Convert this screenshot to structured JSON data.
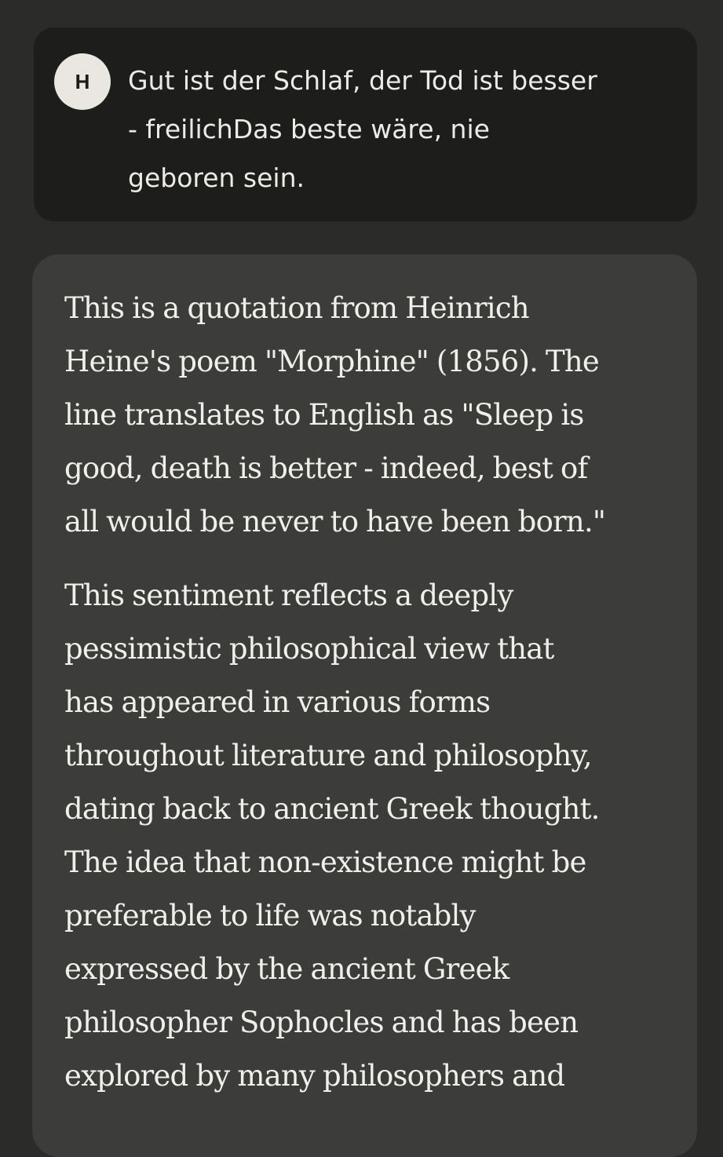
{
  "user_message": {
    "avatar_letter": "H",
    "lines": [
      "Gut ist der Schlaf, der Tod ist besser",
      "- freilichDas beste wäre, nie",
      "geboren sein."
    ]
  },
  "assistant_message": {
    "paragraph_1": [
      "This is a quotation from Heinrich",
      "Heine's poem \"Morphine\" (1856). The",
      "line translates to English as \"Sleep is",
      "good, death is better - indeed, best of",
      "all would be never to have been born.\""
    ],
    "paragraph_2": [
      "This sentiment reflects a deeply",
      "pessimistic philosophical view that",
      "has appeared in various forms",
      "throughout literature and philosophy,",
      "dating back to ancient Greek thought.",
      "The idea that non-existence might be",
      "preferable to life was notably",
      "expressed by the ancient Greek",
      "philosopher Sophocles and has been",
      "explored by many philosophers and"
    ]
  }
}
